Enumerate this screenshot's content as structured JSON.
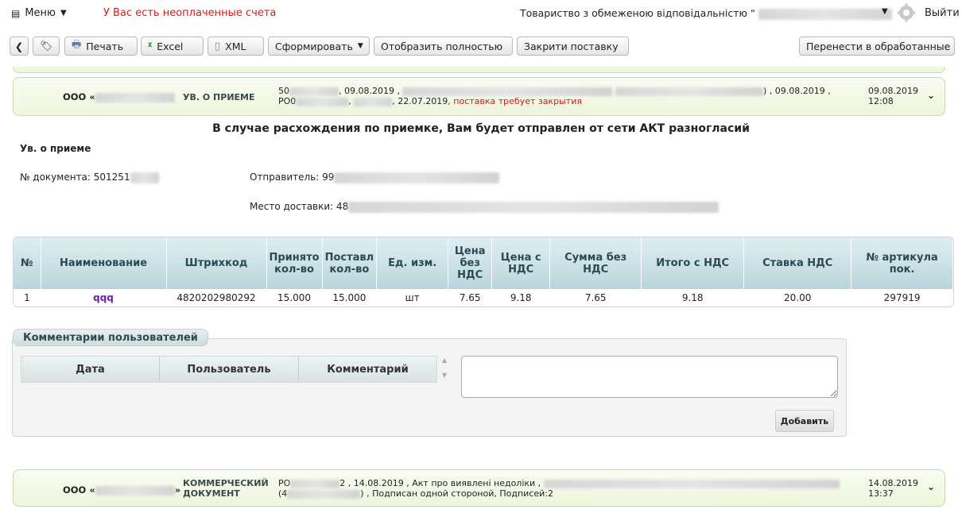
{
  "topbar": {
    "menu_label": "Меню",
    "unpaid_notice": "У Вас есть неоплаченные счета",
    "company_label": "Товариство з обмеженою відповідальністю \"",
    "logout_label": "Выйти"
  },
  "toolbar": {
    "print_label": "Печать",
    "excel_label": "Excel",
    "xml_label": "XML",
    "form_label": "Сформировать",
    "show_full_label": "Отобразить полностью",
    "close_delivery_label": "Закрити поставку",
    "move_processed_label": "Перенести в обработанные"
  },
  "doc1": {
    "org_prefix": "ООО «",
    "type": "УВ. О ПРИЕМЕ",
    "line1_a": "50",
    "line1_b": ", 09.08.2019 , ",
    "line1_c": ") , 09.08.2019 ,",
    "line2_a": "РО0",
    "line2_b": ", ",
    "line2_c": ", 22.07.2019",
    "line2_warning": ", поставка требует закрытия",
    "date": "09.08.2019",
    "time": "12:08"
  },
  "notice": "В случае расхождения по приемке, Вам будет отправлен от сети АКТ разногласий",
  "subtitle": "Ув. о приеме",
  "fields": {
    "doc_number": "№ документа: 501251",
    "sender": "Отправитель: 99",
    "delivery_place": "Место доставки: 48"
  },
  "goods_table": {
    "headers": [
      "№",
      "Наименование",
      "Штрихкод",
      "Принято кол-во",
      "Поставл кол-во",
      "Ед. изм.",
      "Цена без НДС",
      "Цена с НДС",
      "Сумма без НДС",
      "Итого с НДС",
      "Ставка НДС",
      "№ артикула пок."
    ],
    "rows": [
      [
        "1",
        "qqq",
        "4820202980292",
        "15.000",
        "15.000",
        "шт",
        "7.65",
        "9.18",
        "7.65",
        "9.18",
        "20.00",
        "297919"
      ]
    ]
  },
  "comments": {
    "title": "Комментарии пользователей",
    "col_date": "Дата",
    "col_user": "Пользователь",
    "col_comment": "Комментарий",
    "add_label": "Добавить"
  },
  "doc2": {
    "org_prefix": "ООО «",
    "org_suffix": "»",
    "type_line1": "КОММЕРЧЕСКИЙ",
    "type_line2": "ДОКУМЕНТ",
    "line1_a": "РО",
    "line1_b": "2 , 14.08.2019 , Акт про виявлені недоліки ,",
    "line2_a": "(4",
    "line2_b": ") , Подписан одной стороной, Подписей:2",
    "date": "14.08.2019",
    "time": "13:37"
  }
}
